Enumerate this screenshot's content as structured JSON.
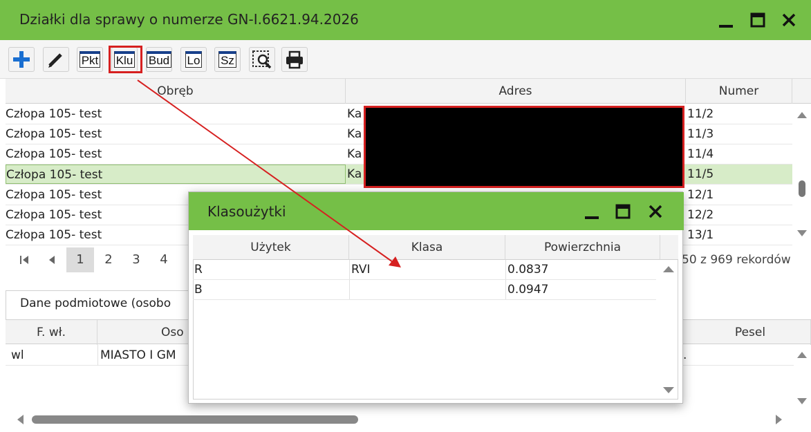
{
  "window": {
    "title": "Działki dla sprawy o numerze GN-I.6621.94.2026"
  },
  "toolbar": {
    "buttons": [
      {
        "name": "add",
        "label": ""
      },
      {
        "name": "edit",
        "label": ""
      },
      {
        "name": "pkt",
        "label": "Pkt"
      },
      {
        "name": "klu",
        "label": "Klu"
      },
      {
        "name": "bud",
        "label": "Bud"
      },
      {
        "name": "lo",
        "label": "Lo"
      },
      {
        "name": "sz",
        "label": "Sz"
      },
      {
        "name": "search",
        "label": ""
      },
      {
        "name": "print",
        "label": ""
      }
    ]
  },
  "parcels": {
    "columns": [
      "Obręb",
      "Adres",
      "Numer"
    ],
    "rows": [
      {
        "obreb": "Człopa 105- test",
        "adres": "Ka",
        "numer": "11/2"
      },
      {
        "obreb": "Człopa 105- test",
        "adres": "Ka",
        "numer": "11/3"
      },
      {
        "obreb": "Człopa 105- test",
        "adres": "Ka",
        "numer": "11/4"
      },
      {
        "obreb": "Człopa 105- test",
        "adres": "Ka",
        "numer": "11/5"
      },
      {
        "obreb": "Człopa 105- test",
        "adres": "",
        "numer": "12/1"
      },
      {
        "obreb": "Człopa 105- test",
        "adres": "",
        "numer": "12/2"
      },
      {
        "obreb": "Człopa 105- test",
        "adres": "",
        "numer": "13/1"
      }
    ],
    "selected_index": 3
  },
  "pager": {
    "pages": [
      "1",
      "2",
      "3",
      "4"
    ],
    "current": "1",
    "records": "50 z 969 rekordów"
  },
  "lower": {
    "tab_label": "Dane podmiotowe (osobo",
    "columns": [
      "F. wł.",
      "Oso",
      "Pesel"
    ],
    "rows": [
      {
        "fwl": "wl",
        "osoba": "MIASTO I GM",
        "pesel": "."
      }
    ]
  },
  "dialog": {
    "title": "Klasoużytki",
    "columns": [
      "Użytek",
      "Klasa",
      "Powierzchnia"
    ],
    "rows": [
      {
        "uzytek": "R",
        "klasa": "RVI",
        "powierzchnia": "0.0837"
      },
      {
        "uzytek": "B",
        "klasa": "",
        "powierzchnia": "0.0947"
      }
    ]
  },
  "colors": {
    "accent": "#75bf47",
    "selection": "#d7ecc8",
    "annotation": "#d62020",
    "redaction": "#000000"
  }
}
